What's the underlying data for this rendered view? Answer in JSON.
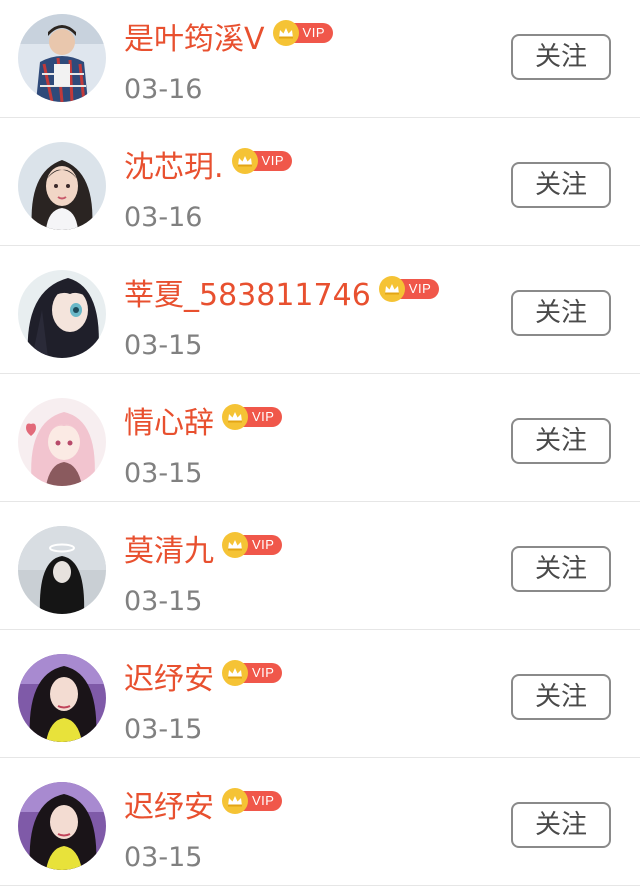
{
  "vip_label": "VIP",
  "colors": {
    "name": "#e8502f",
    "date": "#808080",
    "vip_crown": "#f5c335",
    "vip_tag": "#f0574a",
    "button_border": "#8a8a8a"
  },
  "follow_list": [
    {
      "name": "是叶筠溪V",
      "date": "03-16",
      "button": "关注",
      "avatar_icon": "avatar-photo-boy-plaid-shirt"
    },
    {
      "name": "沈芯玥.",
      "date": "03-16",
      "button": "关注",
      "avatar_icon": "avatar-photo-girl-portrait"
    },
    {
      "name": "莘夏_583811746",
      "date": "03-15",
      "button": "关注",
      "avatar_icon": "avatar-anime-girl-dark-hair"
    },
    {
      "name": "情心辞",
      "date": "03-15",
      "button": "关注",
      "avatar_icon": "avatar-anime-girl-pink-hair"
    },
    {
      "name": "莫清九",
      "date": "03-15",
      "button": "关注",
      "avatar_icon": "avatar-dark-figure-halo"
    },
    {
      "name": "迟纾安",
      "date": "03-15",
      "button": "关注",
      "avatar_icon": "avatar-photo-girl-long-hair"
    },
    {
      "name": "迟纾安",
      "date": "03-15",
      "button": "关注",
      "avatar_icon": "avatar-photo-girl-long-hair"
    }
  ]
}
